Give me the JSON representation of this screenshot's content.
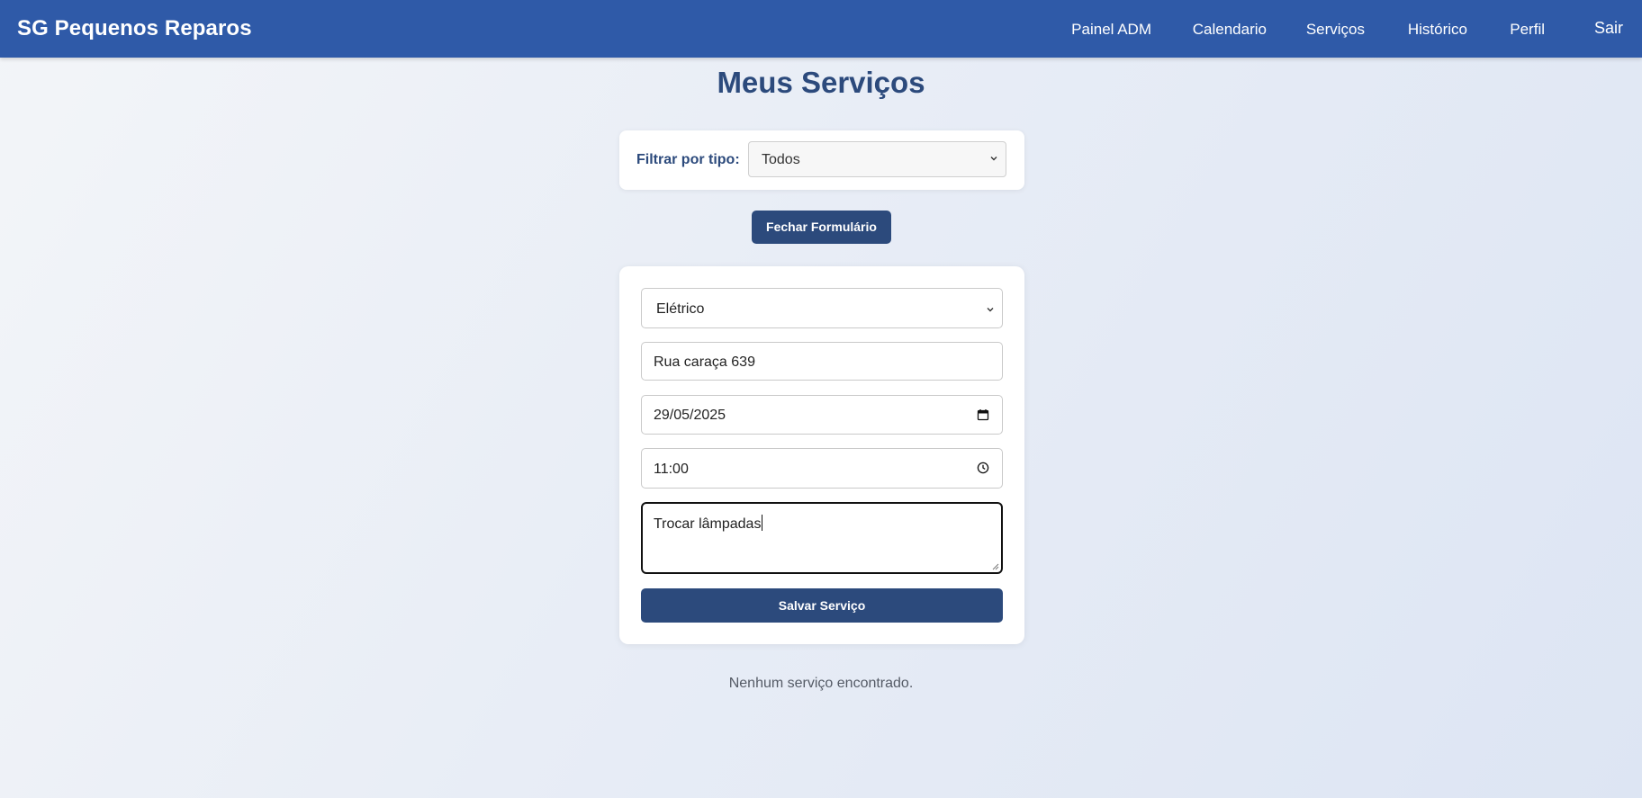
{
  "app": {
    "brand": "SG Pequenos Reparos"
  },
  "nav": {
    "items": [
      {
        "label": "Painel ADM"
      },
      {
        "label": "Calendario"
      },
      {
        "label": "Serviços"
      },
      {
        "label": "Histórico"
      },
      {
        "label": "Perfil"
      },
      {
        "label": "Sair"
      }
    ]
  },
  "page": {
    "title": "Meus Serviços"
  },
  "filter": {
    "label": "Filtrar por tipo:",
    "selected": "Todos"
  },
  "toggle_form_button": "Fechar Formulário",
  "form": {
    "type_selected": "Elétrico",
    "address_value": "Rua caraça 639",
    "date_value": "29/05/2025",
    "time_value": "11:00",
    "description_value": "Trocar lâmpadas",
    "save_label": "Salvar Serviço"
  },
  "empty_state": "Nenhum serviço encontrado.",
  "colors": {
    "topbar": "#2f5aa8",
    "primary": "#2c4a7c",
    "title": "#2c4a7c"
  },
  "icons": {
    "select_chevron": "chevron-down-icon",
    "date": "calendar-icon",
    "time": "clock-icon"
  }
}
